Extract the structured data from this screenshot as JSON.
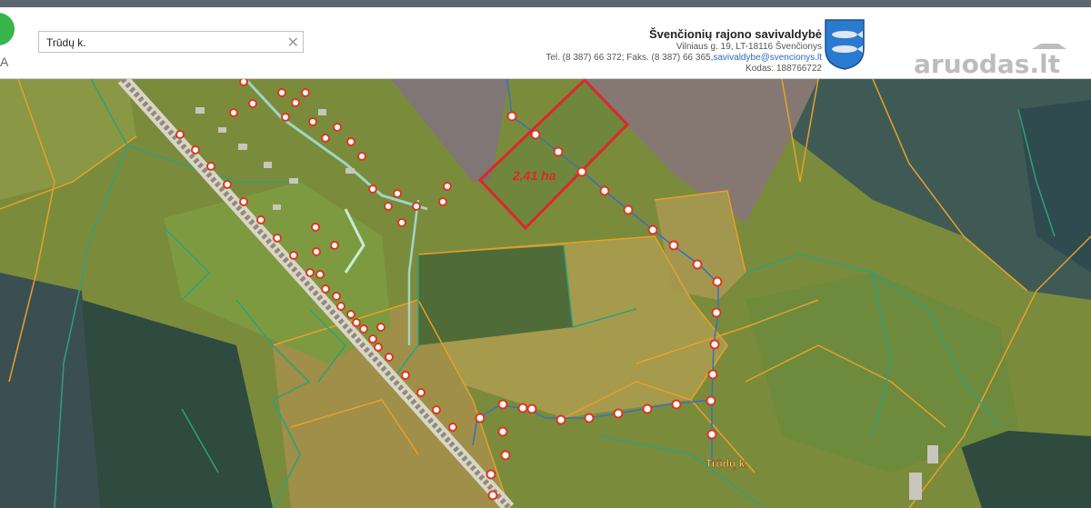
{
  "header": {
    "logo_letter": "A",
    "search": {
      "value": "Trūdų k.",
      "placeholder": ""
    },
    "municipality": {
      "name": "Švenčionių rajono savivaldybė",
      "address": "Vilniaus g. 19, LT-18116 Švenčionys",
      "contacts_prefix": "Tel. (8 387) 66 372; Faks. (8 387) 66 365,",
      "email": "savivaldybe@svencionys.lt",
      "code": "Kodas: 188766722"
    },
    "watermark": "aruodas.lt"
  },
  "toolbar": {
    "icons": [
      "ruler-icon",
      "location-pin-icon",
      "share-icon",
      "target-icon"
    ]
  },
  "map": {
    "area_label": "2,41 ha",
    "village_label": "Trūdų k.",
    "colors": {
      "parcel_highlight": "#e0262a",
      "parcel_border_green": "#2fa07a",
      "parcel_border_orange": "#e6a12a",
      "route_marker_stroke": "#d9391f",
      "route_line": "#3a6fc2"
    }
  }
}
